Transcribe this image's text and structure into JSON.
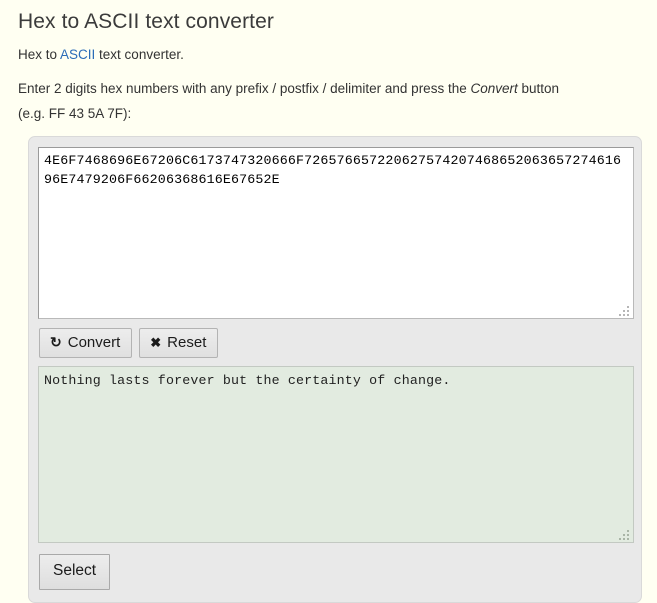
{
  "page": {
    "title": "Hex to ASCII text converter",
    "intro_before_link": "Hex to ",
    "intro_link": "ASCII",
    "intro_after_link": " text converter.",
    "instructions_part1": "Enter 2 digits hex numbers with any prefix / postfix / delimiter and press the ",
    "instructions_emphasis": "Convert",
    "instructions_part2": " button",
    "instructions_example": "(e.g. FF 43 5A 7F):"
  },
  "hex_input": {
    "value": "4E6F7468696E67206C6173747320666F72657665722062757420746865206365727461696E7479206F66206368616E67652E",
    "placeholder": ""
  },
  "actions": {
    "convert_label": "Convert",
    "convert_icon": "refresh-icon",
    "convert_icon_glyph": "↻",
    "reset_label": "Reset",
    "reset_icon": "cross-icon",
    "reset_icon_glyph": "✖"
  },
  "ascii_output": {
    "value": "Nothing lasts forever but the certainty of change."
  },
  "select": {
    "label": "Select"
  },
  "colors": {
    "page_background": "#fffff2",
    "panel_background": "#e9e9e9",
    "input_background": "#ffffff",
    "output_background": "#e2ebe0",
    "link": "#2b6cb8",
    "text": "#333333"
  }
}
